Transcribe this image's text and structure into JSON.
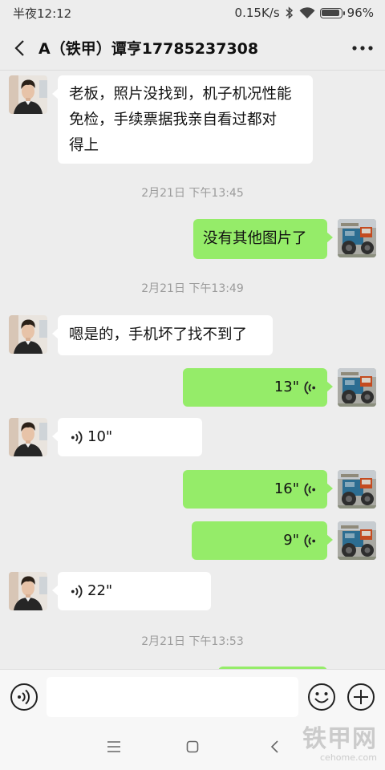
{
  "status_bar": {
    "time": "半夜12:12",
    "speed": "0.15K/s",
    "battery": "96%",
    "battery_level": 0.96
  },
  "header": {
    "title": "A（铁甲）谭亨17785237308"
  },
  "messages": {
    "m1": {
      "text_lines": [
        "老板，照片没找到，机子机况性能",
        "免检，手续票据我亲自看过都对",
        "得上"
      ]
    },
    "t1": "2月21日 下午13:45",
    "m2": {
      "text": "没有其他图片了"
    },
    "t2": "2月21日 下午13:49",
    "m3": {
      "text": "嗯是的，手机坏了找不到了"
    },
    "v1": {
      "duration": "13\""
    },
    "v2": {
      "duration": "10\""
    },
    "v3": {
      "duration": "16\""
    },
    "v4": {
      "duration": "9\""
    },
    "v5": {
      "duration": "22\""
    },
    "t3": "2月21日 下午13:53"
  },
  "input_bar": {
    "placeholder": ""
  },
  "watermark": {
    "main": "铁甲网",
    "sub": "cehome.com"
  },
  "icons": {
    "back": "chevron-left-icon",
    "more": "more-dots-icon",
    "voice_mode": "voice-toggle-icon",
    "emoji": "emoji-icon",
    "plus": "plus-icon",
    "menu": "menu-icon",
    "home": "home-icon",
    "sys_back": "back-icon"
  },
  "colors": {
    "outgoing_bubble": "#95ec69",
    "incoming_bubble": "#ffffff",
    "background": "#ededed"
  }
}
